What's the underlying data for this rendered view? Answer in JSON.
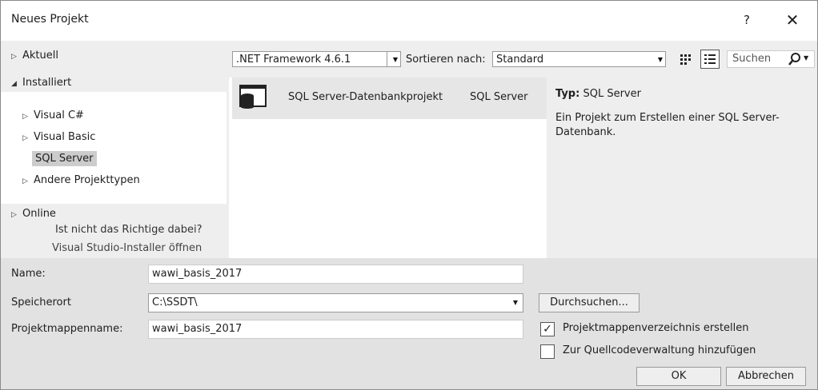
{
  "window": {
    "title": "Neues Projekt",
    "help_glyph": "?",
    "close_glyph": "✕"
  },
  "left_nav": {
    "recent": "Aktuell",
    "installed": "Installiert",
    "installed_items": [
      "Visual C#",
      "Visual Basic",
      "SQL Server",
      "Andere Projekttypen"
    ],
    "selected_item": "SQL Server",
    "online": "Online",
    "not_found_text": "Ist nicht das Richtige dabei?",
    "installer_link": "Visual Studio-Installer öffnen"
  },
  "toolbar": {
    "framework_value": ".NET Framework 4.6.1",
    "sort_label": "Sortieren nach:",
    "sort_value": "Standard",
    "search_placeholder": "Suchen",
    "icons": [
      "small-icons-view-icon",
      "list-view-icon",
      "search-icon"
    ]
  },
  "templates": [
    {
      "name": "SQL Server-Datenbankprojekt",
      "language": "SQL Server",
      "icon": "database-project-icon"
    }
  ],
  "details": {
    "type_label": "Typ:",
    "type_value": "SQL Server",
    "description": "Ein Projekt zum Erstellen einer SQL Server-Datenbank."
  },
  "form": {
    "name_label": "Name:",
    "name_value": "wawi_basis_2017",
    "location_label": "Speicherort",
    "location_value": "C:\\SSDT\\",
    "solution_label": "Projektmappenname:",
    "solution_value": "wawi_basis_2017",
    "browse_label": "Durchsuchen...",
    "create_dir_label": "Projektmappenverzeichnis erstellen",
    "create_dir_checked": true,
    "source_control_label": "Zur Quellcodeverwaltung hinzufügen",
    "source_control_checked": false,
    "ok_label": "OK",
    "cancel_label": "Abbrechen"
  },
  "colors": {
    "selection": "#cccccc",
    "template_selected_bg": "#e6e6e6",
    "bottom_panel": "#e2e2e2"
  }
}
